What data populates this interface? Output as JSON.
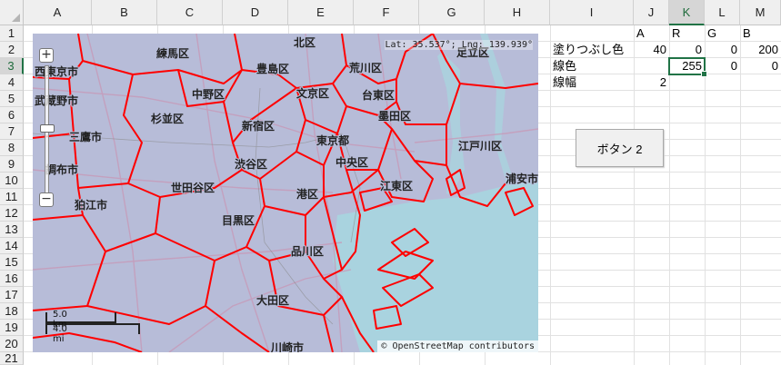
{
  "columns": [
    "A",
    "B",
    "C",
    "D",
    "E",
    "F",
    "G",
    "H",
    "I",
    "J",
    "K",
    "L",
    "M"
  ],
  "rows": [
    "1",
    "2",
    "3",
    "4",
    "5",
    "6",
    "7",
    "8",
    "9",
    "10",
    "11",
    "12",
    "13",
    "14",
    "15",
    "16",
    "17",
    "18",
    "19",
    "20",
    "21"
  ],
  "cells": {
    "j1": "A",
    "k1": "R",
    "l1": "G",
    "m1": "B",
    "i2": "塗りつぶし色",
    "j2": "40",
    "k2": "0",
    "l2": "0",
    "m2": "200",
    "i3": "線色",
    "k3": "255",
    "l3": "0",
    "m3": "0",
    "i4": "線幅",
    "j4": "2"
  },
  "button": {
    "label": "ボタン 2"
  },
  "map": {
    "coord_text": "Lat: 35.537°; Lng: 139.939°",
    "attribution": "© OpenStreetMap contributors",
    "scale_km": "5.0 km",
    "scale_mi": "4.0 mi",
    "zoom_in": "+",
    "zoom_out": "−",
    "wards": {
      "nerima": "練馬区",
      "kita": "北区",
      "toshima": "豊島区",
      "arakawa": "荒川区",
      "adachi": "足立区",
      "nishitokyo": "西東京市",
      "nakano": "中野区",
      "bunkyo": "文京区",
      "taito": "台東区",
      "musashino": "武蔵野市",
      "suginami": "杉並区",
      "shinjuku": "新宿区",
      "sumida": "墨田区",
      "mitaka": "三鷹市",
      "chiyoda": "東京都",
      "edogawa": "江戸川区",
      "chofu": "調布市",
      "shibuya": "渋谷区",
      "chuo": "中央区",
      "setagaya": "世田谷区",
      "koto": "江東区",
      "urayasu": "浦安市",
      "minato": "港区",
      "komae": "狛江市",
      "meguro": "目黒区",
      "shinagawa": "品川区",
      "ota": "大田区",
      "kawasaki": "川崎市"
    }
  },
  "colors": {
    "boundary": "#ff0000",
    "land": "#b7bcd8",
    "water": "#a9d3df",
    "selection": "#217346"
  }
}
